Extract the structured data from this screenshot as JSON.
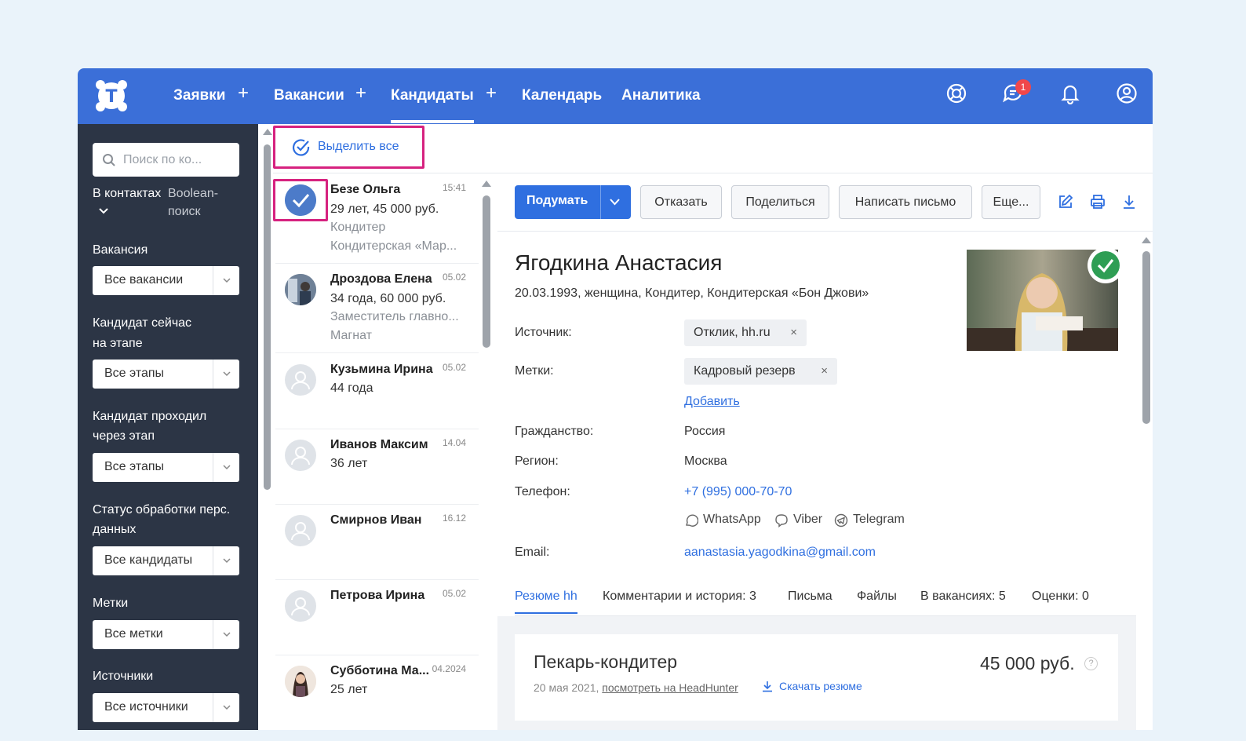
{
  "nav": {
    "items": [
      "Заявки",
      "Вакансии",
      "Кандидаты",
      "Календарь",
      "Аналитика"
    ],
    "active": "Кандидаты",
    "plus": "+",
    "notification_count": "1",
    "logo_letter": "T"
  },
  "sidebar": {
    "search_placeholder": "Поиск по ко...",
    "in_contacts": "В контактах",
    "boolean_search_1": "Boolean-",
    "boolean_search_2": "поиск",
    "filters": [
      {
        "label_1": "Вакансия",
        "label_2": "",
        "value": "Все вакансии"
      },
      {
        "label_1": "Кандидат сейчас",
        "label_2": "на этапе",
        "value": "Все этапы"
      },
      {
        "label_1": "Кандидат проходил",
        "label_2": "через этап",
        "value": "Все этапы"
      },
      {
        "label_1": "Статус обработки перс.",
        "label_2": "данных",
        "value": "Все кандидаты"
      },
      {
        "label_1": "Метки",
        "label_2": "",
        "value": "Все метки"
      },
      {
        "label_1": "Источники",
        "label_2": "",
        "value": "Все источники"
      }
    ]
  },
  "list": {
    "select_all": "Выделить все",
    "candidates": [
      {
        "name": "Безе Ольга",
        "date": "15:41",
        "line2": "29 лет, 45 000 руб.",
        "line3": "Кондитер",
        "line4": "Кондитерская «Мар..."
      },
      {
        "name": "Дроздова Елена",
        "date": "05.02",
        "line2": "34 года, 60 000 руб.",
        "line3": "Заместитель главно...",
        "line4": "Магнат"
      },
      {
        "name": "Кузьмина Ирина",
        "date": "05.02",
        "line2": "44 года",
        "line3": "",
        "line4": ""
      },
      {
        "name": "Иванов Максим",
        "date": "14.04",
        "line2": "36 лет",
        "line3": "",
        "line4": ""
      },
      {
        "name": "Смирнов Иван",
        "date": "16.12",
        "line2": "",
        "line3": "",
        "line4": ""
      },
      {
        "name": "Петрова Ирина",
        "date": "05.02",
        "line2": "",
        "line3": "",
        "line4": ""
      },
      {
        "name": "Субботина Ма...",
        "date": "04.2024",
        "line2": "25 лет",
        "line3": "",
        "line4": ""
      }
    ]
  },
  "toolbar": {
    "think": "Подумать",
    "reject": "Отказать",
    "share": "Поделиться",
    "write": "Написать письмо",
    "more": "Еще..."
  },
  "candidate": {
    "name": "Ягодкина Анастасия",
    "info": "20.03.1993, женщина, Кондитер, Кондитерская «Бон Джови»",
    "source_label": "Источник:",
    "source": "Отклик, hh.ru",
    "tags_label": "Метки:",
    "tag": "Кадровый резерв",
    "add_tag": "Добавить",
    "citizenship_label": "Гражданство:",
    "citizenship": "Россия",
    "region_label": "Регион:",
    "region": "Москва",
    "phone_label": "Телефон:",
    "phone": "+7 (995) 000-70-70",
    "messengers": [
      "WhatsApp",
      "Viber",
      "Telegram"
    ],
    "email_label": "Email:",
    "email": "aanastasia.yagodkina@gmail.com",
    "remove": "×"
  },
  "tabs": [
    "Резюме hh",
    "Комментарии и история: 3",
    "Письма",
    "Файлы",
    "В вакансиях: 5",
    "Оценки: 0"
  ],
  "resume": {
    "title": "Пекарь-кондитер",
    "salary": "45 000 руб.",
    "date": "20 мая 2021,",
    "hh_link": "посмотреть на HeadHunter",
    "download": "Скачать резюме",
    "help": "?"
  },
  "colors": {
    "primary": "#3b6fd8",
    "accent": "#2f6fe0",
    "highlight": "#d6227f",
    "sidebar": "#2c3545",
    "success": "#2e9e54"
  }
}
